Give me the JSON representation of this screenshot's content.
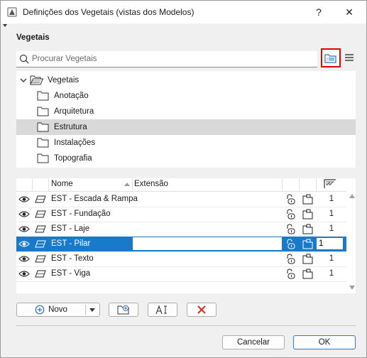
{
  "window": {
    "title": "Definições dos Vegetais (vistas dos Modelos)",
    "help_label": "?",
    "close_label": "✕"
  },
  "section": {
    "label": "Vegetais"
  },
  "search": {
    "placeholder": "Procurar Vegetais",
    "value": ""
  },
  "tree": {
    "root": {
      "label": "Vegetais",
      "expanded": true
    },
    "folders": [
      {
        "label": "Anotação",
        "selected": false
      },
      {
        "label": "Arquitetura",
        "selected": false
      },
      {
        "label": "Estrutura",
        "selected": true
      },
      {
        "label": "Instalações",
        "selected": false
      },
      {
        "label": "Topografia",
        "selected": false
      }
    ]
  },
  "table": {
    "headers": {
      "name": "Nome",
      "extension": "Extensão"
    },
    "rows": [
      {
        "name": "EST - Escada & Rampa",
        "value": "1",
        "selected": false
      },
      {
        "name": "EST - Fundação",
        "value": "1",
        "selected": false
      },
      {
        "name": "EST - Laje",
        "value": "1",
        "selected": false
      },
      {
        "name": "EST - Pilar",
        "value": "1",
        "selected": true
      },
      {
        "name": "EST - Texto",
        "value": "1",
        "selected": false
      },
      {
        "name": "EST - Viga",
        "value": "1",
        "selected": false
      }
    ]
  },
  "toolbar": {
    "new_label": "Novo"
  },
  "footer": {
    "cancel_label": "Cancelar",
    "ok_label": "OK"
  },
  "colors": {
    "selection": "#1979ca",
    "highlight_border": "#e00000",
    "ok_border": "#2b7bd2",
    "delete_icon": "#e02a1b"
  },
  "icons": {
    "app": "app-logo-icon",
    "search": "search-icon",
    "folder_view": "folder-list-icon",
    "menu": "hamburger-menu-icon",
    "visibility": "eye-icon",
    "layer": "layer-plane-icon",
    "lock": "lock-icon",
    "folder_state": "folder-state-icon",
    "intersection": "intersection-hatch-icon",
    "new_folder": "new-folder-icon",
    "rename": "rename-icon",
    "delete": "delete-x-icon"
  }
}
